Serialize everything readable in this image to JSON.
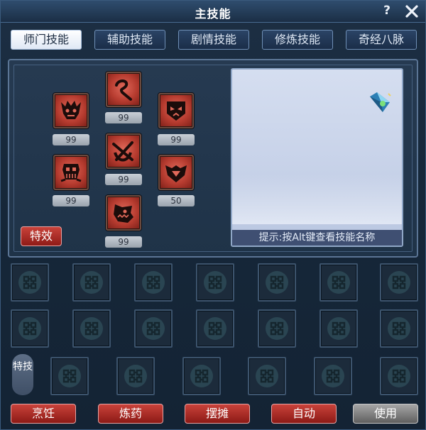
{
  "window": {
    "title": "主技能",
    "help": "?"
  },
  "tabs": [
    "师门技能",
    "辅助技能",
    "剧情技能",
    "修炼技能",
    "奇经八脉"
  ],
  "skills": [
    {
      "icon": "demon-face-icon",
      "level": "99"
    },
    {
      "icon": "whip-icon",
      "level": "99"
    },
    {
      "icon": "mask-icon",
      "level": "99"
    },
    {
      "icon": "skull-cage-icon",
      "level": "99"
    },
    {
      "icon": "crossed-blades-icon",
      "level": "99"
    },
    {
      "icon": "bat-wing-icon",
      "level": "50"
    },
    {
      "icon": "beast-head-icon",
      "level": "99"
    }
  ],
  "effect_button": "特效",
  "hint": "提示:按Alt键查看技能名称",
  "special_label": "特技",
  "bottom_buttons": {
    "cook": "烹饪",
    "alchemy": "炼药",
    "stall": "摆摊",
    "auto": "自动",
    "use": "使用"
  },
  "colors": {
    "accent_red": "#b8352c",
    "panel_light": "#c6d1e8",
    "frame_blue": "#16283a"
  }
}
